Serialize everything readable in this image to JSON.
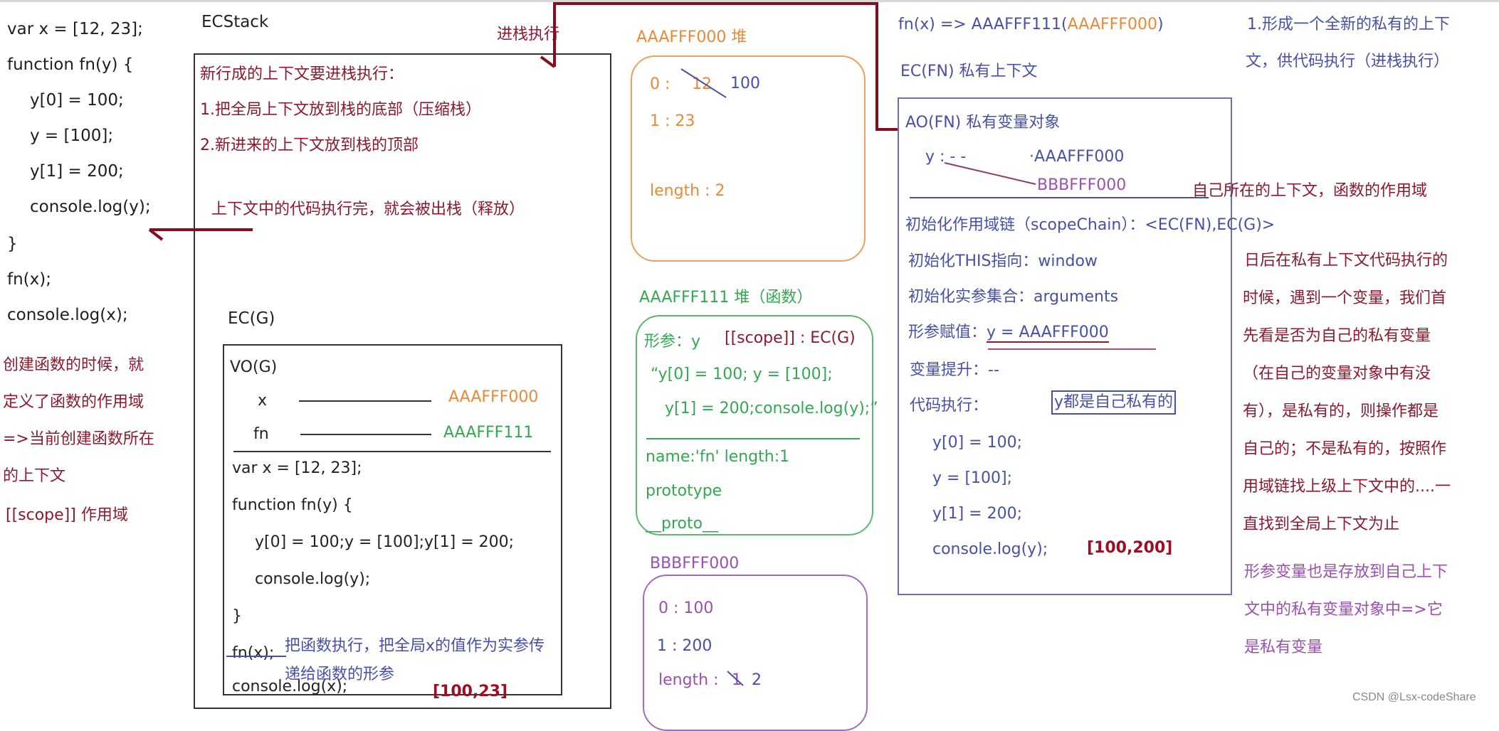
{
  "source_code": {
    "lines": [
      "var x = [12, 23];",
      "function fn(y) {",
      "y[0] = 100;",
      "y = [100];",
      "y[1] = 200;",
      "console.log(y);",
      "}",
      "fn(x);",
      "console.log(x);"
    ]
  },
  "left_notes": {
    "lines": [
      "创建函数的时候，就",
      "定义了函数的作用域",
      "=>当前创建函数所在",
      "的上下文"
    ],
    "scope_note": "[[scope]] 作用域"
  },
  "ecstack": {
    "title": "ECStack",
    "push_label": "进栈执行",
    "notes": [
      "新行成的上下文要进栈执行：",
      "1.把全局上下文放到栈的底部（压缩栈）",
      "2.新进来的上下文放到栈的顶部"
    ],
    "pop_note": "上下文中的代码执行完，就会被出栈（释放）"
  },
  "ec_g": {
    "title": "EC(G)",
    "vo_title": "VO(G)",
    "vars": [
      {
        "name": "x",
        "ref": "AAAFFF000"
      },
      {
        "name": "fn",
        "ref": "AAAFFF111"
      }
    ],
    "code": [
      "var x = [12, 23];",
      "function fn(y) {",
      "y[0] = 100;y = [100];y[1] = 200;",
      "console.log(y);",
      "}",
      "fn(x);",
      "console.log(x);"
    ],
    "call_note_1": "把函数执行，把全局x的值作为实参传",
    "call_note_2": "递给函数的形参",
    "output": "[100,23]"
  },
  "heap_array_x": {
    "title": "AAAFFF000   堆",
    "item0_key": "0  :",
    "item0_old": "12",
    "item0_new": "100",
    "item1": "1  :  23",
    "length": "length : 2"
  },
  "heap_function": {
    "title": "AAAFFF111  堆（函数）",
    "param": "形参：y",
    "scope": "[[scope]] : EC(G)",
    "body_1": "“y[0] = 100; y = [100];",
    "body_2": "y[1] = 200;console.log(y);”",
    "name_len": "name:'fn'   length:1",
    "prototype": "prototype",
    "proto": "__proto__"
  },
  "heap_array_y": {
    "title": "BBBFFF000",
    "item0": "0 : 100",
    "item1": "1 : 200",
    "length_key": "length :",
    "length_old": "1",
    "length_new": "2"
  },
  "ec_fn": {
    "call_prefix": "fn(x) => AAAFFF111(",
    "call_arg": "AAAFFF000",
    "call_suffix": ")",
    "title": "EC(FN)  私有上下文",
    "ao_title": "AO(FN)  私有变量对象",
    "y_label": "y :  -   -",
    "y_ref_old": "·AAAFFF000",
    "y_ref_new": "BBBFFF000",
    "scope_chain": "初始化作用域链（scopeChain）：<EC(FN),EC(G)>",
    "this_init": "初始化THIS指向：window",
    "args_init": "初始化实参集合：arguments",
    "param_assign_label": "形参赋值：",
    "param_assign_value": "y = AAAFFF000",
    "hoisting": "变量提升：--",
    "exec_label": "代码执行：",
    "private_badge": "y都是自己私有的",
    "code": [
      "y[0] = 100;",
      "y = [100];",
      "y[1] = 200;",
      "console.log(y);"
    ],
    "output": "[100,200]"
  },
  "right_notes": {
    "step1": [
      "1.形成一个全新的私有的上下",
      "文，供代码执行（进栈执行）"
    ],
    "scope_note": "自己所在的上下文，函数的作用域",
    "lookup": [
      "日后在私有上下文代码执行的",
      "时候，遇到一个变量，我们首",
      "先看是否为自己的私有变量",
      "（在自己的变量对象中有没",
      "有），是私有的，则操作都是",
      "自己的；不是私有的，按照作",
      "用域链找上级上下文中的....一",
      "直找到全局上下文为止"
    ],
    "param_note": [
      "形参变量也是存放到自己上下",
      "文中的私有变量对象中=>它",
      "是私有变量"
    ]
  },
  "watermark": "CSDN @Lsx-codeShare",
  "colors": {
    "note_red": "#8b1a2e",
    "arrow_red": "#8a0a1e",
    "heap_orange": "#e9893a",
    "heap_green": "#33a852",
    "heap_purple": "#9b4fb0",
    "ec_blue": "#4750a8",
    "output_maroon": "#9a0f24"
  }
}
